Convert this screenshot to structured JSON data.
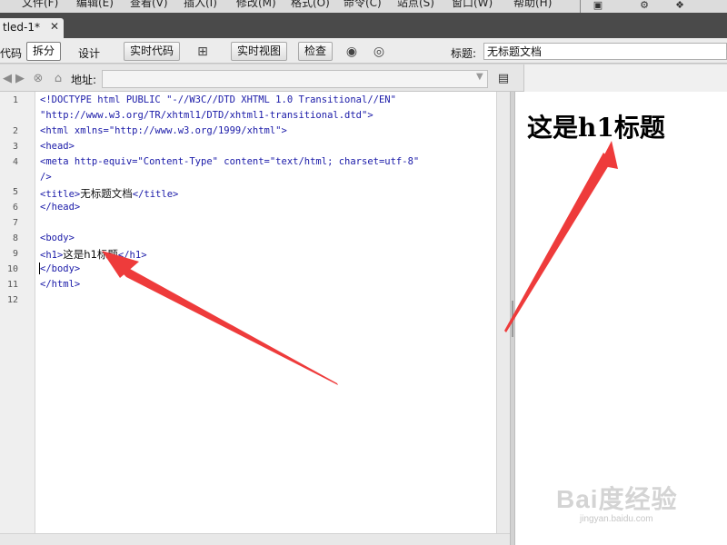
{
  "menu": {
    "items": [
      "文件(F)",
      "编辑(E)",
      "查看(V)",
      "插入(I)",
      "修改(M)",
      "格式(O)",
      "命令(C)",
      "站点(S)",
      "窗口(W)",
      "帮助(H)"
    ],
    "icons": [
      "layout-icon",
      "gear-icon",
      "workspace-icon"
    ]
  },
  "document_tab": {
    "label": "tled-1*",
    "close": "✕"
  },
  "toolbar": {
    "code_label": "代码",
    "split_label": "拆分",
    "design_label": "设计",
    "live_code_label": "实时代码",
    "live_view_label": "实时视图",
    "inspect_label": "检查",
    "title_label": "标题:",
    "title_value": "无标题文档"
  },
  "address_bar": {
    "label": "地址:",
    "value": ""
  },
  "editor": {
    "line_numbers": [
      "1",
      "2",
      "3",
      "4",
      "5",
      "6",
      "7",
      "8",
      "9",
      "10",
      "11",
      "12"
    ],
    "lines": [
      "<!DOCTYPE html PUBLIC \"-//W3C//DTD XHTML 1.0 Transitional//EN\"",
      "\"http://www.w3.org/TR/xhtml1/DTD/xhtml1-transitional.dtd\">",
      "<html xmlns=\"http://www.w3.org/1999/xhtml\">",
      "<head>",
      "<meta http-equiv=\"Content-Type\" content=\"text/html; charset=utf-8\"",
      "/>",
      "<title>",
      "无标题文档",
      "</title>",
      "</head>",
      "<body>",
      "<h1>",
      "这是h1标题",
      "</h1>",
      "</body>",
      "</html>"
    ]
  },
  "preview": {
    "heading": "这是h1标题"
  },
  "watermark": {
    "brand": "Bai度经验",
    "url": "jingyan.baidu.com"
  },
  "colors": {
    "code_tag": "#1a1aa8",
    "arrow": "#ee3b3b",
    "tab_bar": "#4a4a4a"
  }
}
